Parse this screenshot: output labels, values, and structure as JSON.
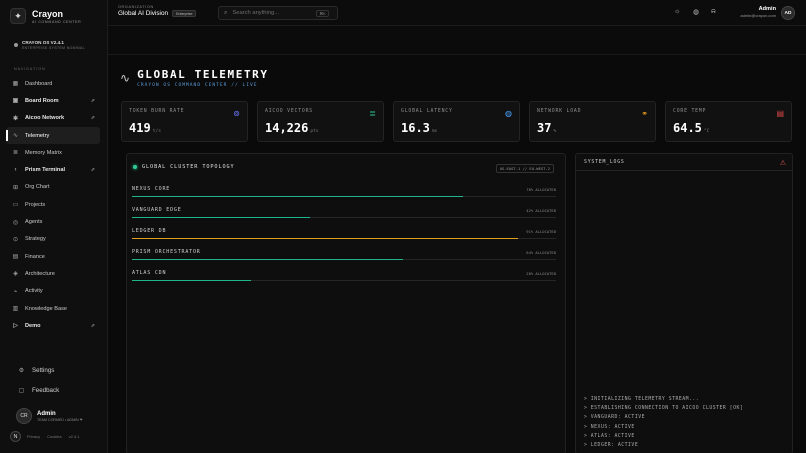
{
  "brand": {
    "name": "Crayon",
    "subtitle": "AI COMMAND CENTER",
    "logo_glyph": "✦"
  },
  "system": {
    "title": "CRAYON OS V2.4.1",
    "subtitle": "ENTERPRISE SYSTEM NOMINAL"
  },
  "nav": {
    "label": "NAVIGATION",
    "items": [
      {
        "label": "Dashboard",
        "icon": "grid-icon",
        "glyph": "▦",
        "active": false,
        "link": false,
        "bold": false
      },
      {
        "label": "Board Room",
        "icon": "briefcase-icon",
        "glyph": "▣",
        "active": false,
        "link": true,
        "bold": true
      },
      {
        "label": "Aicoo Network",
        "icon": "network-icon",
        "glyph": "✱",
        "active": false,
        "link": true,
        "bold": true
      },
      {
        "label": "Telemetry",
        "icon": "pulse-icon",
        "glyph": "∿",
        "active": true,
        "link": false,
        "bold": false
      },
      {
        "label": "Memory Matrix",
        "icon": "database-icon",
        "glyph": "≣",
        "active": false,
        "link": false,
        "bold": false
      },
      {
        "label": "Prism Terminal",
        "icon": "terminal-icon",
        "glyph": "›",
        "active": false,
        "link": true,
        "bold": true
      },
      {
        "label": "Org Chart",
        "icon": "org-chart-icon",
        "glyph": "⊞",
        "active": false,
        "link": false,
        "bold": false
      },
      {
        "label": "Projects",
        "icon": "folder-icon",
        "glyph": "▭",
        "active": false,
        "link": false,
        "bold": false
      },
      {
        "label": "Agents",
        "icon": "bot-icon",
        "glyph": "◎",
        "active": false,
        "link": false,
        "bold": false
      },
      {
        "label": "Strategy",
        "icon": "target-icon",
        "glyph": "⊙",
        "active": false,
        "link": false,
        "bold": false
      },
      {
        "label": "Finance",
        "icon": "wallet-icon",
        "glyph": "▤",
        "active": false,
        "link": false,
        "bold": false
      },
      {
        "label": "Architecture",
        "icon": "layers-icon",
        "glyph": "◈",
        "active": false,
        "link": false,
        "bold": false
      },
      {
        "label": "Activity",
        "icon": "activity-icon",
        "glyph": "⌁",
        "active": false,
        "link": false,
        "bold": false
      },
      {
        "label": "Knowledge Base",
        "icon": "book-icon",
        "glyph": "▥",
        "active": false,
        "link": false,
        "bold": false
      },
      {
        "label": "Demo",
        "icon": "play-icon",
        "glyph": "▷",
        "active": false,
        "link": true,
        "bold": true
      }
    ],
    "link_glyph": "⇗"
  },
  "bottom": {
    "settings_label": "Settings",
    "settings_glyph": "⚙",
    "feedback_label": "Feedback",
    "feedback_glyph": "▢"
  },
  "user": {
    "name": "Admin",
    "initials": "CR",
    "subtitle": "TEAM CORMED • ADMIN ⚑",
    "email": "admin@crayon.com",
    "header_initials": "AD"
  },
  "footer": {
    "badge": "N",
    "privacy": "Privacy",
    "cookies": "Cookies",
    "version": "v2.4.1"
  },
  "header": {
    "org_label": "ORGANIZATION",
    "org_name": "Global AI Division",
    "org_badge": "Enterprise",
    "search_placeholder": "Search anything...",
    "search_shortcut": "⌘K",
    "icons": {
      "theme": "☼",
      "globe": "◍",
      "bell": "⍾"
    }
  },
  "page": {
    "title": "GLOBAL TELEMETRY",
    "subtitle": "CRAYON OS COMMAND CENTER // LIVE"
  },
  "cards": [
    {
      "label": "TOKEN BURN RATE",
      "value": "419",
      "unit": "t/s",
      "icon": "cpu-icon",
      "glyph": "⊚",
      "color": "#6b7bff"
    },
    {
      "label": "AICOO VECTORS",
      "value": "14,226",
      "unit": "pts",
      "icon": "database-icon",
      "glyph": "≣",
      "color": "#2ecc9a"
    },
    {
      "label": "GLOBAL LATENCY",
      "value": "16.3",
      "unit": "ms",
      "icon": "globe-icon",
      "glyph": "◍",
      "color": "#4aa3ff"
    },
    {
      "label": "NETWORK LOAD",
      "value": "37",
      "unit": "%",
      "icon": "network-icon",
      "glyph": "⚭",
      "color": "#f0a020"
    },
    {
      "label": "CORE TEMP",
      "value": "64.5",
      "unit": "°C",
      "icon": "server-icon",
      "glyph": "▤",
      "color": "#e04848"
    }
  ],
  "topology": {
    "title": "GLOBAL CLUSTER TOPOLOGY",
    "region": "US-EAST-1 // EU-WEST-2",
    "clusters": [
      {
        "name": "NEXUS CORE",
        "percent": 78,
        "label": "78% ALLOCATED",
        "color": "#1fb58a"
      },
      {
        "name": "VANGUARD EDGE",
        "percent": 42,
        "label": "42% ALLOCATED",
        "color": "#1fb58a"
      },
      {
        "name": "LEDGER DB",
        "percent": 91,
        "label": "91% ALLOCATED",
        "color": "#e0a020"
      },
      {
        "name": "PRISM ORCHESTRATOR",
        "percent": 64,
        "label": "64% ALLOCATED",
        "color": "#1fb58a"
      },
      {
        "name": "ATLAS CDN",
        "percent": 28,
        "label": "28% ALLOCATED",
        "color": "#1fb58a"
      }
    ]
  },
  "logs": {
    "title": "SYSTEM_LOGS",
    "warn_glyph": "⚠",
    "lines": [
      "> INITIALIZING TELEMETRY STREAM...",
      "> ESTABLISHING CONNECTION TO AICOO CLUSTER [OK]",
      "> VANGUARD: ACTIVE",
      "> NEXUS: ACTIVE",
      "> ATLAS: ACTIVE",
      "> LEDGER: ACTIVE"
    ]
  }
}
